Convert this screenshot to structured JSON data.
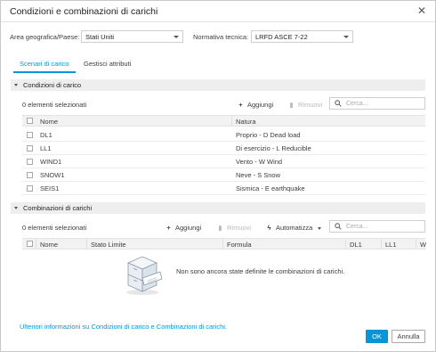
{
  "dialog": {
    "title": "Condizioni e combinazioni di carichi",
    "close_glyph": "✕"
  },
  "settings": {
    "area_label": "Area geografica/Paese:",
    "area_value": "Stati Uniti",
    "norm_label": "Normativa tecnica:",
    "norm_value": "LRFD ASCE 7-22"
  },
  "tabs": [
    {
      "label": "Scenari di carico",
      "active": true
    },
    {
      "label": "Gestisci attributi",
      "active": false
    }
  ],
  "load_conditions": {
    "section_title": "Condizioni di carico",
    "selected_count": "0 elementi selezionati",
    "add_label": "Aggiungi",
    "remove_label": "Rimuovi",
    "search_placeholder": "Cerca...",
    "columns": [
      "Nome",
      "Natura"
    ],
    "rows": [
      {
        "name": "DL1",
        "nature": "Proprio - D Dead load"
      },
      {
        "name": "LL1",
        "nature": "Di esercizio - L Reducible"
      },
      {
        "name": "WIND1",
        "nature": "Vento - W Wind"
      },
      {
        "name": "SNOW1",
        "nature": "Neve - S Snow"
      },
      {
        "name": "SEIS1",
        "nature": "Sismica - E earthquake"
      }
    ]
  },
  "load_combinations": {
    "section_title": "Combinazioni di carichi",
    "selected_count": "0 elementi selezionati",
    "add_label": "Aggiungi",
    "remove_label": "Rimuovi",
    "automate_label": "Automatizza",
    "search_placeholder": "Cerca...",
    "columns": [
      "Nome",
      "Stato Limite",
      "Formula",
      "DL1",
      "LL1",
      "W"
    ],
    "empty_message": "Non sono ancora state definite le combinazioni di carichi."
  },
  "footer": {
    "help_link": "Ulteriori informazioni su Condizioni di carico e Combinazioni di carichi.",
    "ok_label": "OK",
    "cancel_label": "Annulla"
  },
  "colors": {
    "accent": "#0696d7",
    "section_bg": "#eeeeee",
    "header_bg": "#f2f2f2"
  }
}
